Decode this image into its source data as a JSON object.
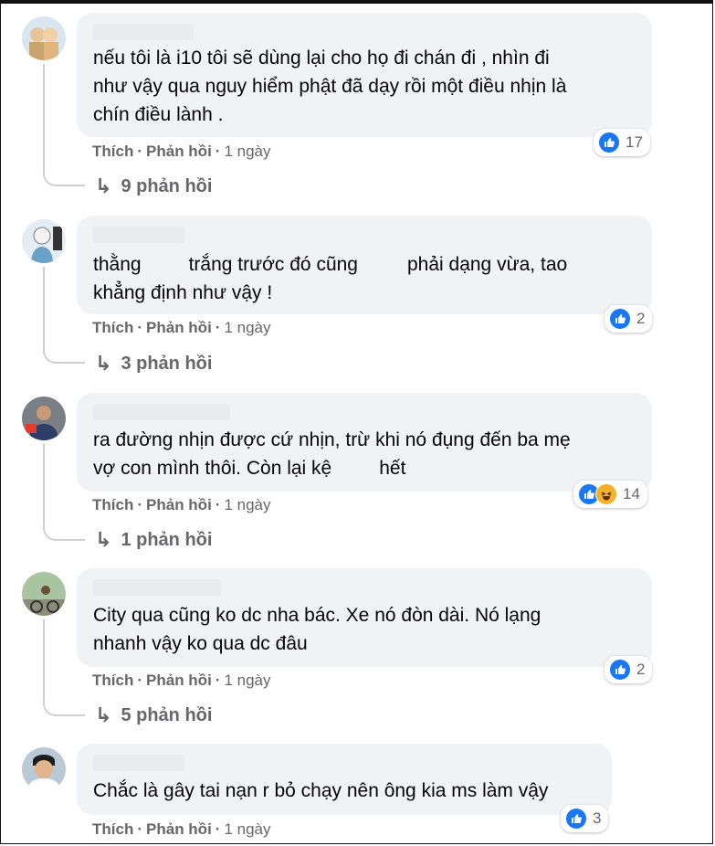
{
  "comments": [
    {
      "text_lines": [
        "nếu tôi là i10 tôi sẽ dùng lại cho họ đi chán đi , nhìn đi",
        "như vậy qua nguy hiểm phật đã dạy rồi một điều nhịn là",
        "chín điều lành ."
      ],
      "like_label": "Thích",
      "reply_label": "Phản hồi",
      "time": "1 ngày",
      "reaction_count": "17",
      "replies_label": "9 phản hồi"
    },
    {
      "text_lines_parts": [
        [
          "thằng",
          "trắng trước đó cũng",
          "phải dạng vừa, tao"
        ],
        [
          "khẳng định như vậy !"
        ]
      ],
      "like_label": "Thích",
      "reply_label": "Phản hồi",
      "time": "1 ngày",
      "reaction_count": "2",
      "replies_label": "3 phản hồi"
    },
    {
      "text_lines_parts": [
        [
          "ra đường nhịn được cứ nhịn, trừ khi nó đụng đến ba mẹ"
        ],
        [
          "vợ con mình thôi. Còn lại kệ",
          "hết"
        ]
      ],
      "like_label": "Thích",
      "reply_label": "Phản hồi",
      "time": "1 ngày",
      "reaction_count": "14",
      "replies_label": "1 phản hồi"
    },
    {
      "text_lines": [
        "City qua cũng ko dc nha bác. Xe nó đòn dài. Nó lạng",
        "nhanh vậy ko qua dc đâu"
      ],
      "like_label": "Thích",
      "reply_label": "Phản hồi",
      "time": "1 ngày",
      "reaction_count": "2",
      "replies_label": "5 phản hồi"
    },
    {
      "text_lines": [
        "Chắc là gây tai nạn r bỏ chạy nên ông kia ms làm vậy"
      ],
      "like_label": "Thích",
      "reply_label": "Phản hồi",
      "time": "1 ngày",
      "reaction_count": "3"
    }
  ],
  "colors": {
    "like_blue": "#1877f2",
    "bubble": "#f0f2f5",
    "meta_gray": "#65676b"
  },
  "icons": {
    "like": "like-icon",
    "haha": "haha-icon",
    "reply_arrow": "reply-arrow-icon"
  }
}
